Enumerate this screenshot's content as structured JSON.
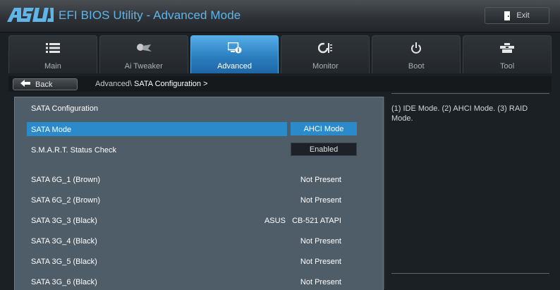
{
  "app": {
    "brand": "ASUS",
    "title": "EFI BIOS Utility - Advanced Mode",
    "exit_label": "Exit"
  },
  "tabs": [
    {
      "label": "Main",
      "icon": "list-icon"
    },
    {
      "label": "Ai Tweaker",
      "icon": "ai-tweaker-icon"
    },
    {
      "label": "Advanced",
      "icon": "advanced-icon",
      "active": true
    },
    {
      "label": "Monitor",
      "icon": "monitor-icon"
    },
    {
      "label": "Boot",
      "icon": "power-icon"
    },
    {
      "label": "Tool",
      "icon": "tool-icon"
    }
  ],
  "breadcrumb": {
    "back_label": "Back",
    "path": "Advanced\\",
    "current": "SATA Configuration",
    "arrow": ">"
  },
  "panel": {
    "section_title": "SATA Configuration",
    "sata_mode": {
      "label": "SATA Mode",
      "value": "AHCI Mode"
    },
    "smart": {
      "label": "S.M.A.R.T. Status Check",
      "value": "Enabled"
    },
    "ports": [
      {
        "label": "SATA 6G_1 (Brown)",
        "value": "Not Present"
      },
      {
        "label": "SATA 6G_2 (Brown)",
        "value": "Not Present"
      },
      {
        "label": "SATA 3G_3 (Black)",
        "value": "ASUS   CB-521 ATAPI"
      },
      {
        "label": "SATA 3G_4 (Black)",
        "value": "Not Present"
      },
      {
        "label": "SATA 3G_5 (Black)",
        "value": "Not Present"
      },
      {
        "label": "SATA 3G_6 (Black)",
        "value": "Not Present"
      }
    ]
  },
  "help": {
    "text": "(1) IDE Mode. (2) AHCI Mode. (3) RAID Mode."
  },
  "colors": {
    "accent": "#2b8ac9",
    "title_blue": "#5fb5e8",
    "panel_bg": "#4e5d68"
  }
}
